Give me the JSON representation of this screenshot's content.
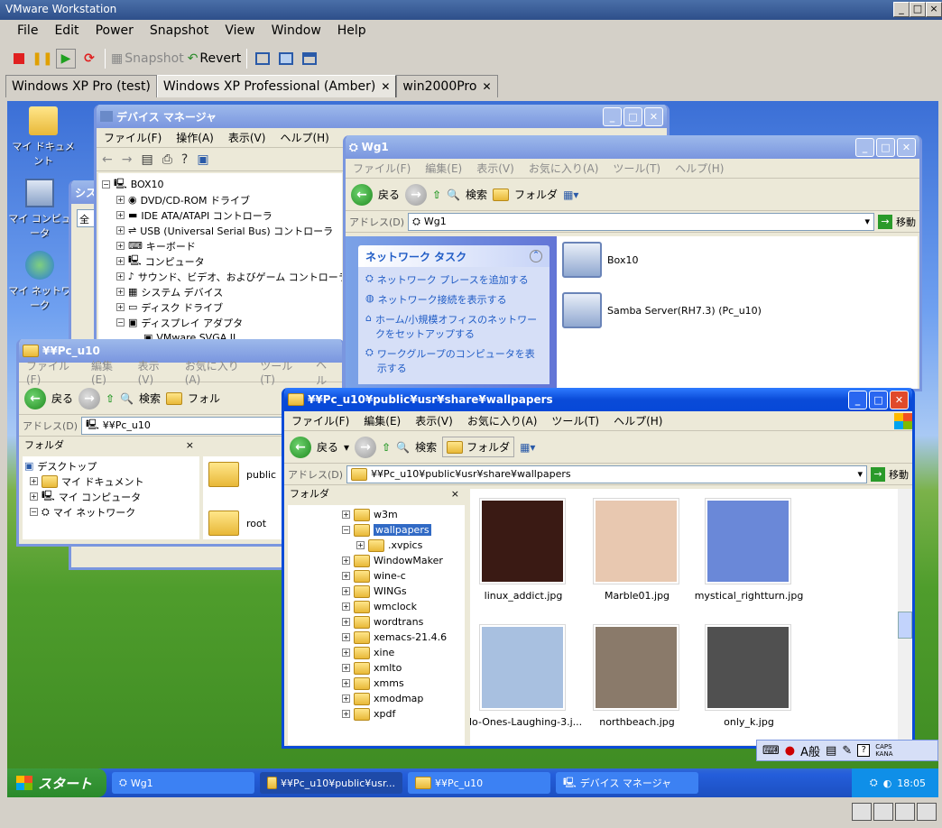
{
  "host": {
    "title": "VMware Workstation",
    "menu": [
      "File",
      "Edit",
      "Power",
      "Snapshot",
      "View",
      "Window",
      "Help"
    ],
    "toolbar": {
      "snapshot": "Snapshot",
      "revert": "Revert"
    },
    "tabs": [
      "Windows XP Pro (test)",
      "Windows XP Professional (Amber)",
      "win2000Pro"
    ]
  },
  "desktop": {
    "icons": [
      "マイ ドキュメント",
      "マイ コンピュータ",
      "マイ ネットワーク"
    ]
  },
  "device_manager": {
    "title": "デバイス マネージャ",
    "menu": [
      "ファイル(F)",
      "操作(A)",
      "表示(V)",
      "ヘルプ(H)"
    ],
    "tree": [
      "BOX10",
      "DVD/CD-ROM ドライブ",
      "IDE ATA/ATAPI コントローラ",
      "USB (Universal Serial Bus) コントローラ",
      "キーボード",
      "コンピュータ",
      "サウンド、ビデオ、およびゲーム コントローラ",
      "システム デバイス",
      "ディスク ドライブ",
      "ディスプレイ アダプタ",
      "VMware SVGA II"
    ]
  },
  "sys_partial": {
    "title": "シス",
    "field": "全"
  },
  "wg1": {
    "title": "Wg1",
    "menu": [
      "ファイル(F)",
      "編集(E)",
      "表示(V)",
      "お気に入り(A)",
      "ツール(T)",
      "ヘルプ(H)"
    ],
    "back": "戻る",
    "search": "検索",
    "folder": "フォルダ",
    "address_label": "アドレス(D)",
    "address": "Wg1",
    "go": "移動",
    "task_title": "ネットワーク タスク",
    "tasks": [
      "ネットワーク プレースを追加する",
      "ネットワーク接続を表示する",
      "ホーム/小規模オフィスのネットワークをセットアップする",
      "ワークグループのコンピュータを表示する"
    ],
    "items": [
      "Box10",
      "Samba Server(RH7.3) (Pc_u10)"
    ]
  },
  "pcu10": {
    "title": "¥¥Pc_u10",
    "menu": [
      "ファイル(F)",
      "編集(E)",
      "表示(V)",
      "お気に入り(A)",
      "ツール(T)",
      "ヘル"
    ],
    "back": "戻る",
    "search": "検索",
    "folder": "フォル",
    "address_label": "アドレス(D)",
    "address": "¥¥Pc_u10",
    "pane_title": "フォルダ",
    "close": "×",
    "tree": [
      "デスクトップ",
      "マイ ドキュメント",
      "マイ コンピュータ",
      "マイ ネットワーク"
    ],
    "items": [
      "public",
      "root"
    ]
  },
  "wall": {
    "title": "¥¥Pc_u10¥public¥usr¥share¥wallpapers",
    "menu": [
      "ファイル(F)",
      "編集(E)",
      "表示(V)",
      "お気に入り(A)",
      "ツール(T)",
      "ヘルプ(H)"
    ],
    "back": "戻る",
    "search": "検索",
    "folder": "フォルダ",
    "address_label": "アドレス(D)",
    "address": "¥¥Pc_u10¥public¥usr¥share¥wallpapers",
    "go": "移動",
    "pane_title": "フォルダ",
    "close": "×",
    "tree": [
      "w3m",
      "wallpapers",
      ".xvpics",
      "WindowMaker",
      "wine-c",
      "WINGs",
      "wmclock",
      "wordtrans",
      "xemacs-21.4.6",
      "xine",
      "xmlto",
      "xmms",
      "xmodmap",
      "xpdf"
    ],
    "files": [
      "linux_addict.jpg",
      "Marble01.jpg",
      "mystical_rightturn.jpg",
      "No-Ones-Laughing-3.j...",
      "northbeach.jpg",
      "only_k.jpg"
    ],
    "thumb_colors": [
      "#3a1a14",
      "#e8c8b0",
      "#6a88d8",
      "#a8c0e0",
      "#8a7a6a",
      "#505050"
    ]
  },
  "ime": {
    "text": "A般",
    "caps": "CAPS",
    "kana": "KANA"
  },
  "taskbar": {
    "start": "スタート",
    "tasks": [
      "Wg1",
      "¥¥Pc_u10¥public¥usr...",
      "¥¥Pc_u10",
      "デバイス マネージャ"
    ],
    "time": "18:05"
  }
}
